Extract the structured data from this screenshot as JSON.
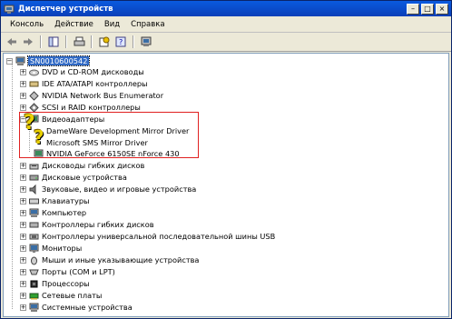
{
  "window": {
    "title": "Диспетчер устройств"
  },
  "menu": [
    "Консоль",
    "Действие",
    "Вид",
    "Справка"
  ],
  "tree": {
    "root": "SN0010600542",
    "nodes": [
      {
        "label": "DVD и CD-ROM дисководы",
        "icon": "dvd-icon"
      },
      {
        "label": "IDE ATA/ATAPI контроллеры",
        "icon": "ide-icon"
      },
      {
        "label": "NVIDIA Network Bus Enumerator",
        "icon": "network-icon"
      },
      {
        "label": "SCSI и RAID контроллеры",
        "icon": "scsi-icon"
      },
      {
        "label": "Видеоадаптеры",
        "icon": "display-icon",
        "expanded": true,
        "children": [
          "DameWare Development Mirror Driver",
          "Microsoft SMS Mirror Driver",
          "NVIDIA GeForce 6150SE nForce 430"
        ]
      },
      {
        "label": "Дисководы гибких дисков",
        "icon": "floppy-icon"
      },
      {
        "label": "Дисковые устройства",
        "icon": "disk-icon"
      },
      {
        "label": "Звуковые, видео и игровые устройства",
        "icon": "sound-icon"
      },
      {
        "label": "Клавиатуры",
        "icon": "keyboard-icon"
      },
      {
        "label": "Компьютер",
        "icon": "computer-icon"
      },
      {
        "label": "Контроллеры гибких дисков",
        "icon": "floppy-controller-icon"
      },
      {
        "label": "Контроллеры универсальной последовательной шины USB",
        "icon": "usb-icon"
      },
      {
        "label": "Мониторы",
        "icon": "monitor-icon"
      },
      {
        "label": "Мыши и иные указывающие устройства",
        "icon": "mouse-icon"
      },
      {
        "label": "Порты (COM и LPT)",
        "icon": "port-icon"
      },
      {
        "label": "Процессоры",
        "icon": "cpu-icon"
      },
      {
        "label": "Сетевые платы",
        "icon": "network-card-icon"
      },
      {
        "label": "Системные устройства",
        "icon": "system-icon"
      }
    ]
  },
  "colors": {
    "selection": "#316ac5",
    "highlight_box": "#e02020",
    "titlebar": "#0a5adf"
  }
}
